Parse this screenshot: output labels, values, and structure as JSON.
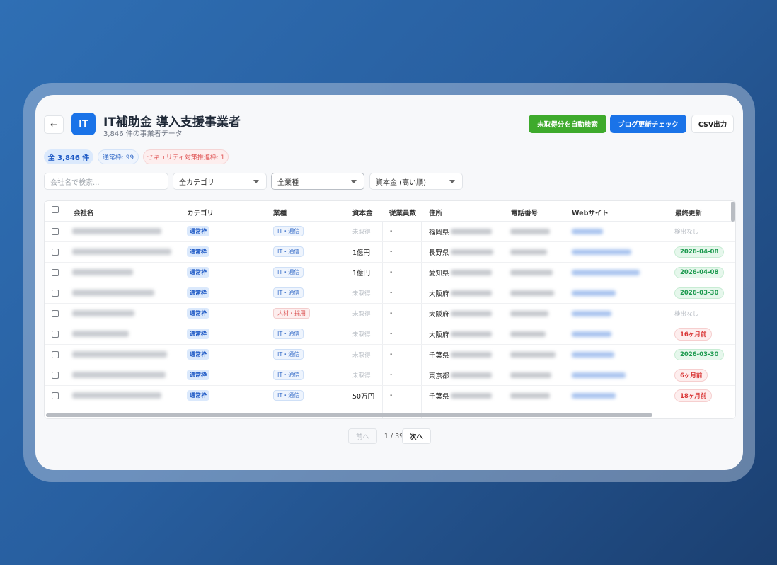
{
  "header": {
    "back_icon": "←",
    "logo_text": "IT",
    "title": "IT補助金 導入支援事業者",
    "subtitle": "3,846 件の事業者データ",
    "actions": {
      "auto_search": "未取得分を自動検索",
      "blog_check": "ブログ更新チェック",
      "csv": "CSV出力"
    }
  },
  "filters": {
    "chips": {
      "total": "全 3,846 件",
      "normal": "通常枠: 99",
      "security": "セキュリティ対策推進枠: 1"
    },
    "search_placeholder": "会社名で検索...",
    "category": "全カテゴリ",
    "industry": "全業種",
    "capital_sort": "資本金 (高い順)"
  },
  "table": {
    "columns": [
      "会社名",
      "カテゴリ",
      "業種",
      "資本金",
      "従業員数",
      "住所",
      "電話番号",
      "Webサイト",
      "最終更新"
    ],
    "rows": [
      {
        "category": "通常枠",
        "industry": "IT・通信",
        "industry_type": "it",
        "capital": "未取得",
        "employees": "-",
        "address": "福岡県",
        "updated": "検出なし",
        "updated_type": "none"
      },
      {
        "category": "通常枠",
        "industry": "IT・通信",
        "industry_type": "it",
        "capital": "1億円",
        "employees": "-",
        "address": "長野県",
        "updated": "2026-04-08",
        "updated_type": "green"
      },
      {
        "category": "通常枠",
        "industry": "IT・通信",
        "industry_type": "it",
        "capital": "1億円",
        "employees": "-",
        "address": "愛知県",
        "updated": "2026-04-08",
        "updated_type": "green"
      },
      {
        "category": "通常枠",
        "industry": "IT・通信",
        "industry_type": "it",
        "capital": "未取得",
        "employees": "-",
        "address": "大阪府",
        "updated": "2026-03-30",
        "updated_type": "green"
      },
      {
        "category": "通常枠",
        "industry": "人材・採用",
        "industry_type": "hr",
        "capital": "未取得",
        "employees": "-",
        "address": "大阪府",
        "updated": "検出なし",
        "updated_type": "none"
      },
      {
        "category": "通常枠",
        "industry": "IT・通信",
        "industry_type": "it",
        "capital": "未取得",
        "employees": "-",
        "address": "大阪府",
        "updated": "16ヶ月前",
        "updated_type": "red"
      },
      {
        "category": "通常枠",
        "industry": "IT・通信",
        "industry_type": "it",
        "capital": "未取得",
        "employees": "-",
        "address": "千葉県",
        "updated": "2026-03-30",
        "updated_type": "green"
      },
      {
        "category": "通常枠",
        "industry": "IT・通信",
        "industry_type": "it",
        "capital": "未取得",
        "employees": "-",
        "address": "東京都",
        "updated": "6ヶ月前",
        "updated_type": "red"
      },
      {
        "category": "通常枠",
        "industry": "IT・通信",
        "industry_type": "it",
        "capital": "50万円",
        "employees": "-",
        "address": "千葉県",
        "updated": "18ヶ月前",
        "updated_type": "red"
      }
    ]
  },
  "pagination": {
    "prev": "前へ",
    "info": "1 / 39",
    "next": "次へ"
  },
  "colors": {
    "primary": "#1a73e8",
    "success": "#3eaa2c",
    "danger": "#d93636"
  }
}
